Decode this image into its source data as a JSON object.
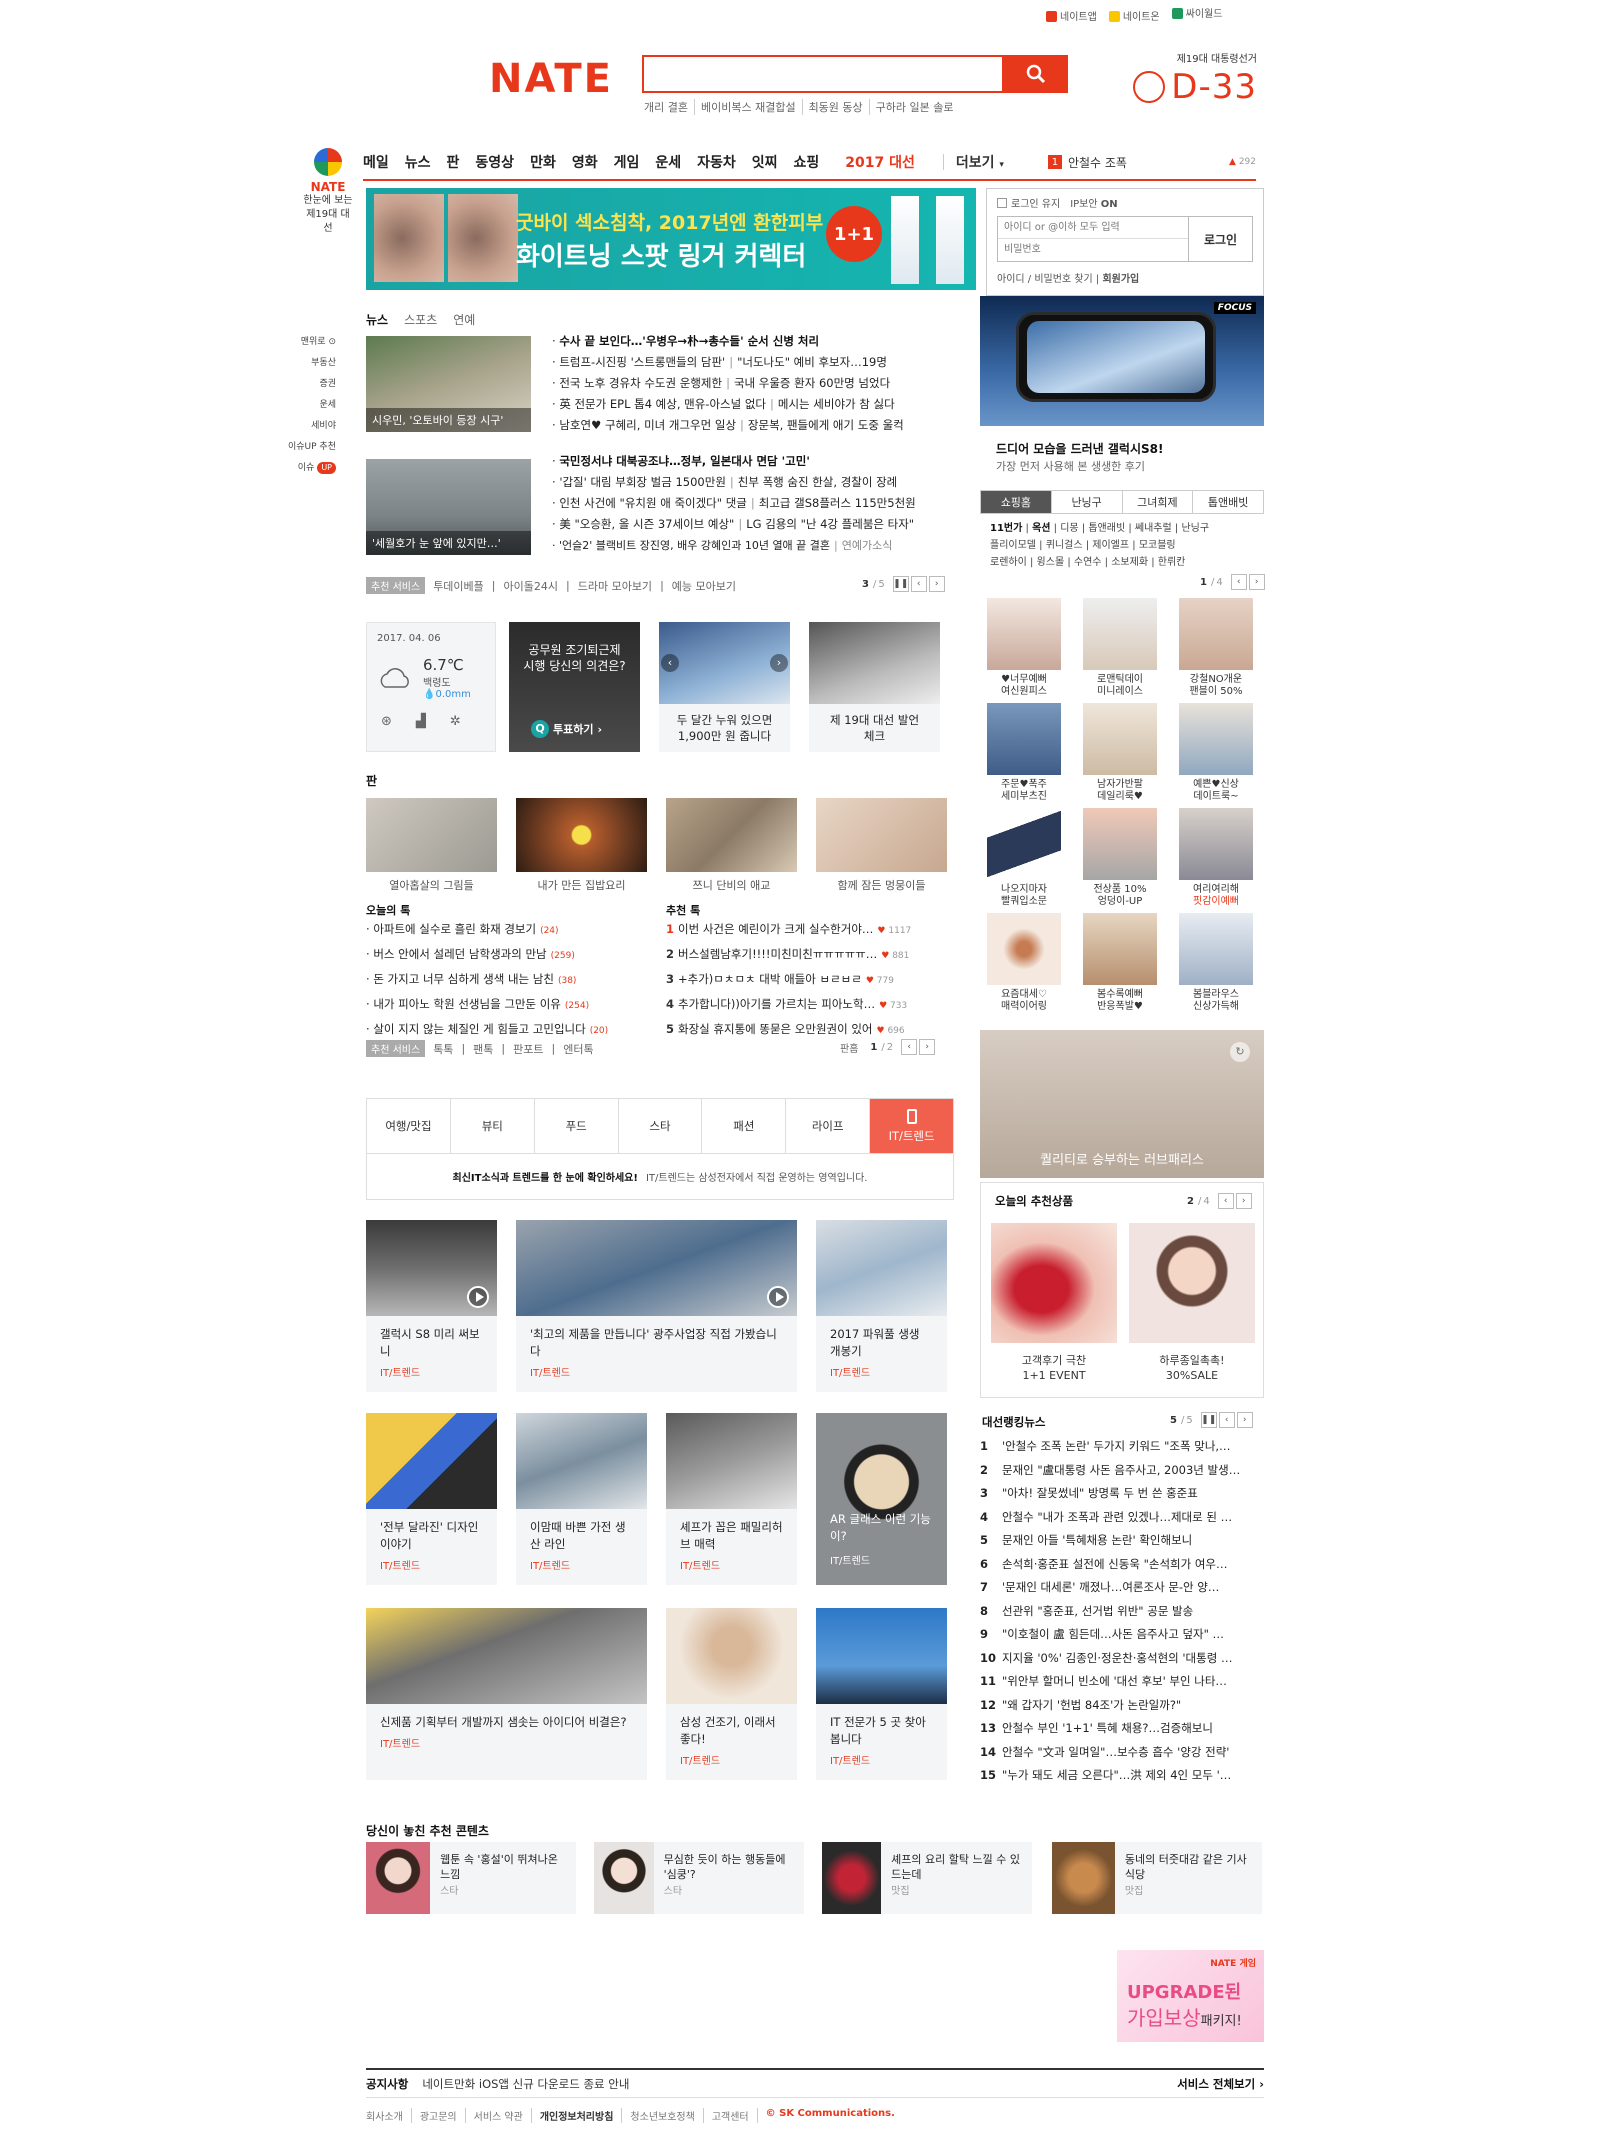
{
  "top_links": [
    "네이트앱",
    "네이트온",
    "싸이월드"
  ],
  "brand": {
    "logo": "NATE",
    "accent": "#e8381b"
  },
  "search": {
    "placeholder": "",
    "icon": "search-icon"
  },
  "keywords": [
    "개리 결혼",
    "베이비복스 재결합설",
    "최동원 동상",
    "구하라 일본 솔로"
  ],
  "election": {
    "title": "제19대 대통령선거",
    "dday": "D-33"
  },
  "gnb": {
    "items": [
      "메일",
      "뉴스",
      "판",
      "동영상",
      "만화",
      "영화",
      "게임",
      "운세",
      "자동차",
      "잇찌",
      "쇼핑"
    ],
    "special": "2017 대선",
    "more": "더보기",
    "rank_no": "1",
    "rank_text": "안철수 조폭",
    "rank_count": "292"
  },
  "left_logo": {
    "name": "NATE",
    "line1": "한눈에 보는",
    "line2": "제19대 대선"
  },
  "left_menu": [
    "맨위로",
    "부동산",
    "증권",
    "운세",
    "세비야",
    "이슈UP 추천",
    "이슈"
  ],
  "left_menu_badge": "UP",
  "banner": {
    "line1": "굿바이 섹소침착, 2017년엔 환한피부",
    "line2": "화이트닝 스팟 링거 커렉터",
    "badge": "1+1"
  },
  "login": {
    "keep": "로그인 유지",
    "ip": "IP보안",
    "ip_on": "ON",
    "id_placeholder": "아이디 or @이하 모두 입력",
    "pw_placeholder": "비밀번호",
    "button": "로그인",
    "find": "아이디 / 비밀번호 찾기",
    "join": "회원가입"
  },
  "news_tabs": [
    "뉴스",
    "스포츠",
    "연예"
  ],
  "news_group1": {
    "thumb_caption": "시우민, '오토바이 등장 시구'",
    "headline": "수사 끝 보인다…'우병우→朴→총수들' 순서 신병 처리",
    "items": [
      [
        "트럼프-시진핑 '스트롱맨들의 담판'",
        "\"너도나도\" 예비 후보자…19명"
      ],
      [
        "전국 노후 경유차 수도권 운행제한",
        "국내 우울증 환자 60만명 넘었다"
      ],
      [
        "英 전문가 EPL 톱4 예상, 맨유-아스널 없다",
        "메시는 세비야가 참 싫다"
      ],
      [
        "남호연♥ 구혜리, 미녀 개그우먼 일상",
        "장문복, 팬들에게 애기 도중 울컥"
      ]
    ]
  },
  "news_group2": {
    "thumb_caption": "'세월호가 눈 앞에 있지만…'",
    "headline": "국민정서냐 대북공조냐…정부, 일본대사 면담 '고민'",
    "items": [
      [
        "'갑질' 대림 부회장 벌금 1500만원",
        "친부 폭행 숨진 한살, 경찰이 장례"
      ],
      [
        "인천 사건에 \"유치원 애 죽이겠다\" 댓글",
        "최고급 갤S8플러스 115만5천원"
      ],
      [
        "美 \"오승환, 올 시즌 37세이브 예상\"",
        "LG 김용의 \"난 4강 플레붐은 타자\""
      ],
      [
        "'언슬2' 블랙비트 장진영, 배우 강혜인과 10년 열애 끝 결혼",
        "연예가소식"
      ]
    ]
  },
  "service_bar1": {
    "tag": "추천 서비스",
    "items": [
      "투데이베플",
      "아이돌24시",
      "드라마 모아보기",
      "예능 모아보기"
    ],
    "page": "3",
    "total": "5"
  },
  "weather": {
    "date": "2017. 04. 06",
    "temp": "6.7℃",
    "place": "백령도",
    "rain": "0.0mm"
  },
  "poll": {
    "text": "공무원 조기퇴근제 시행 당신의 의견은?",
    "button": "투표하기"
  },
  "promo_cards": [
    {
      "text": "두 달간 누워 있으면 1,900만 원 줍니다"
    },
    {
      "text": "제 19대 대선 발언 체크"
    }
  ],
  "pann": {
    "title": "판",
    "thumbs": [
      "열아홉살의 그림들",
      "내가 만든 집밥요리",
      "쯔니 단비의 애교",
      "함께 잠든 멍뭉이들"
    ],
    "today_title": "오늘의 톡",
    "today": [
      {
        "text": "아파트에 실수로 흘린 화재 경보기",
        "n": "(24)"
      },
      {
        "text": "버스 안에서 설레던 남학생과의 만남",
        "n": "(259)"
      },
      {
        "text": "돈 가지고 너무 심하게 생색 내는 남친",
        "n": "(38)"
      },
      {
        "text": "내가 피아노 학원 선생님을 그만둔 이유",
        "n": "(254)"
      },
      {
        "text": "살이 지지 않는 체질인 게 힘들고 고민입니다",
        "n": "(20)"
      }
    ],
    "rec_title": "추천 톡",
    "rec": [
      {
        "no": "1",
        "text": "이번 사건은 예린이가 크게 실수한거야…",
        "c": "1117"
      },
      {
        "no": "2",
        "text": "버스설렘남후기!!!!미친미친ㅠㅠㅠㅠㅠ…",
        "c": "881"
      },
      {
        "no": "3",
        "text": "+추가)ㅁㅊㅁㅊ 대박 애들아 ㅂㄹㅂㄹ",
        "c": "779"
      },
      {
        "no": "4",
        "text": "추가합니다))아기를 가르치는 피아노학…",
        "c": "733"
      },
      {
        "no": "5",
        "text": "화장실 휴지통에 똥묻은 오만원권이 있어",
        "c": "696"
      }
    ]
  },
  "service_bar2": {
    "tag": "추천 서비스",
    "items": [
      "톡톡",
      "팬톡",
      "판포트",
      "엔터톡"
    ],
    "pan_label": "판홈",
    "page": "1",
    "total": "2"
  },
  "sub_tabs": [
    "여행/맛집",
    "뷰티",
    "푸드",
    "스타",
    "패션",
    "라이프",
    "IT/트렌드"
  ],
  "sub_info": {
    "bold": "최신IT소식과 트렌드를 한 눈에 확인하세요!",
    "normal": "IT/트렌드는 삼성전자에서 직접 운영하는 영역입니다."
  },
  "it_cards": [
    {
      "t": "갤럭시 S8 미리 써보니",
      "cat": "IT/트렌드",
      "video": true
    },
    {
      "t": "'최고의 제품을 만듭니다' 광주사업장 직접 가봤습니다",
      "cat": "IT/트렌드",
      "video": true
    },
    {
      "t": "2017 파워풀 생생 개봉기",
      "cat": "IT/트렌드",
      "video": false
    },
    {
      "t": "'전부 달라진' 디자인 이야기",
      "cat": "IT/트렌드"
    },
    {
      "t": "이맘때 바쁜 가전 생산 라인",
      "cat": "IT/트렌드"
    },
    {
      "t": "셰프가 꼽은 패밀리허브 매력",
      "cat": "IT/트렌드"
    },
    {
      "t": "AR 글래스 이런 기능이?",
      "cat": "IT/트렌드"
    },
    {
      "t": "신제품 기획부터 개발까지 샘솟는 아이디어 비결은?",
      "cat": "IT/트렌드"
    },
    {
      "t": "삼성 건조기, 이래서 좋다!",
      "cat": "IT/트렌드"
    },
    {
      "t": "IT 전문가 5 곳 찾아봅니다",
      "cat": "IT/트렌드"
    }
  ],
  "focus_ad": {
    "tag": "FOCUS",
    "title": "드디어 모습을 드러낸 갤럭시S8!",
    "sub": "가장 먼저 사용해 본 생생한 후기"
  },
  "shop_tabs": [
    "쇼핑홈",
    "난닝구",
    "그녀희제",
    "톱앤배빗"
  ],
  "shop_kw": {
    "lead": "11번가",
    "lead2": "옥션",
    "items": [
      "디몽",
      "톱앤래빗",
      "쎄내추럴",
      "난닝구",
      "플리이모델",
      "퀴니걸스",
      "제이엘프",
      "모코블링",
      "로렌하이",
      "윙스몰",
      "수연수",
      "소보제화",
      "한뤼칸"
    ],
    "page": "1",
    "total": "4"
  },
  "shop_items": [
    {
      "l1": "♥너무예뻐",
      "l2": "여신원피스"
    },
    {
      "l1": "로맨틱데이",
      "l2": "미니레이스"
    },
    {
      "l1": "강철NO개운",
      "l2": "팬블이 50%"
    },
    {
      "l1": "주문♥폭주",
      "l2": "세미부츠진"
    },
    {
      "l1": "남자가반팔",
      "l2": "데일리룩♥"
    },
    {
      "l1": "예쁜♥신상",
      "l2": "데이트룩~"
    },
    {
      "l1": "나오지마자",
      "l2": "빨쿼입소문"
    },
    {
      "l1": "전상품 10%",
      "l2": "엉덩이-UP"
    },
    {
      "l1": "여리여리해",
      "l2": "핏감이예뻐",
      "red": true
    },
    {
      "l1": "요즘대세♡",
      "l2": "매력이어링"
    },
    {
      "l1": "봄수록예뻐",
      "l2": "반응폭발♥"
    },
    {
      "l1": "봄블라우스",
      "l2": "신상가득해"
    }
  ],
  "love_ad": {
    "caption": "퀄리티로 승부하는 러브패리스"
  },
  "rec_products": {
    "title": "오늘의 추천상품",
    "page": "2",
    "total": "4",
    "items": [
      {
        "l1": "고객후기 극찬",
        "l2": "1+1 EVENT"
      },
      {
        "l1": "하루종일촉촉!",
        "l2": "30%SALE"
      }
    ]
  },
  "rank_news": {
    "title": "대선랭킹뉴스",
    "page": "5",
    "total": "5",
    "items": [
      "'안철수 조폭 논란' 두가지 키워드 \"조폭 맞나,…",
      "문재인 \"盧대통령 사돈 음주사고, 2003년 발생…",
      "\"아차! 잘못썼네\" 방명록 두 번 쓴 홍준표",
      "안철수 \"내가 조폭과 관련 있겠나…제대로 된 …",
      "문재인 아들 '특혜채용 논란' 확인해보니",
      "손석희·홍준표 설전에 신동욱 \"손석희가 여우…",
      "'문재인 대세론' 깨졌나…여론조사 문-안 양…",
      "선관위 \"홍준표, 선거법 위반\" 공문 발송",
      "\"이호철이 盧 힘든데…사돈 음주사고 덮자\" …",
      "지지율 '0%' 김종인·정운찬·홍석현의 '대통령 …",
      "\"위안부 할머니 빈소에 '대선 후보' 부인 나타…",
      "\"왜 갑자기 '헌법 84조'가 논란일까?\"",
      "안철수 부인 '1+1' 특혜 채용?…검증해보니",
      "안철수 \"文과 일며일\"…보수층 흡수 '양강 전략'",
      "\"누가 돼도 세금 오른다\"…洪 제외 4인 모두 '…"
    ]
  },
  "missed": {
    "title": "당신이 놓친 추천 콘텐츠",
    "items": [
      {
        "t": "웹툰 속 '홍설'이 뛰쳐나온 느낌",
        "s": "스타"
      },
      {
        "t": "무심한 듯이 하는 행동들에 '심쿵'?",
        "s": "스타"
      },
      {
        "t": "셰프의 요리 할탁 느낄 수 있드는데",
        "s": "맛집"
      },
      {
        "t": "동네의 터줏대감 같은 기사 식당",
        "s": "맛집"
      }
    ]
  },
  "game_ad": {
    "brand": "NATE 게임",
    "l1": "UPGRADE된",
    "l2": "가입보상",
    "l3": "패키지!"
  },
  "notice": {
    "label": "공지사항",
    "text": "네이트만화 iOS앱 신규 다운로드 종료 안내",
    "all": "서비스 전체보기"
  },
  "footer": [
    "회사소개",
    "광고문의",
    "서비스 약관",
    "개인정보처리방침",
    "청소년보호정책",
    "고객센터"
  ],
  "footer_copy": "© SK Communications."
}
